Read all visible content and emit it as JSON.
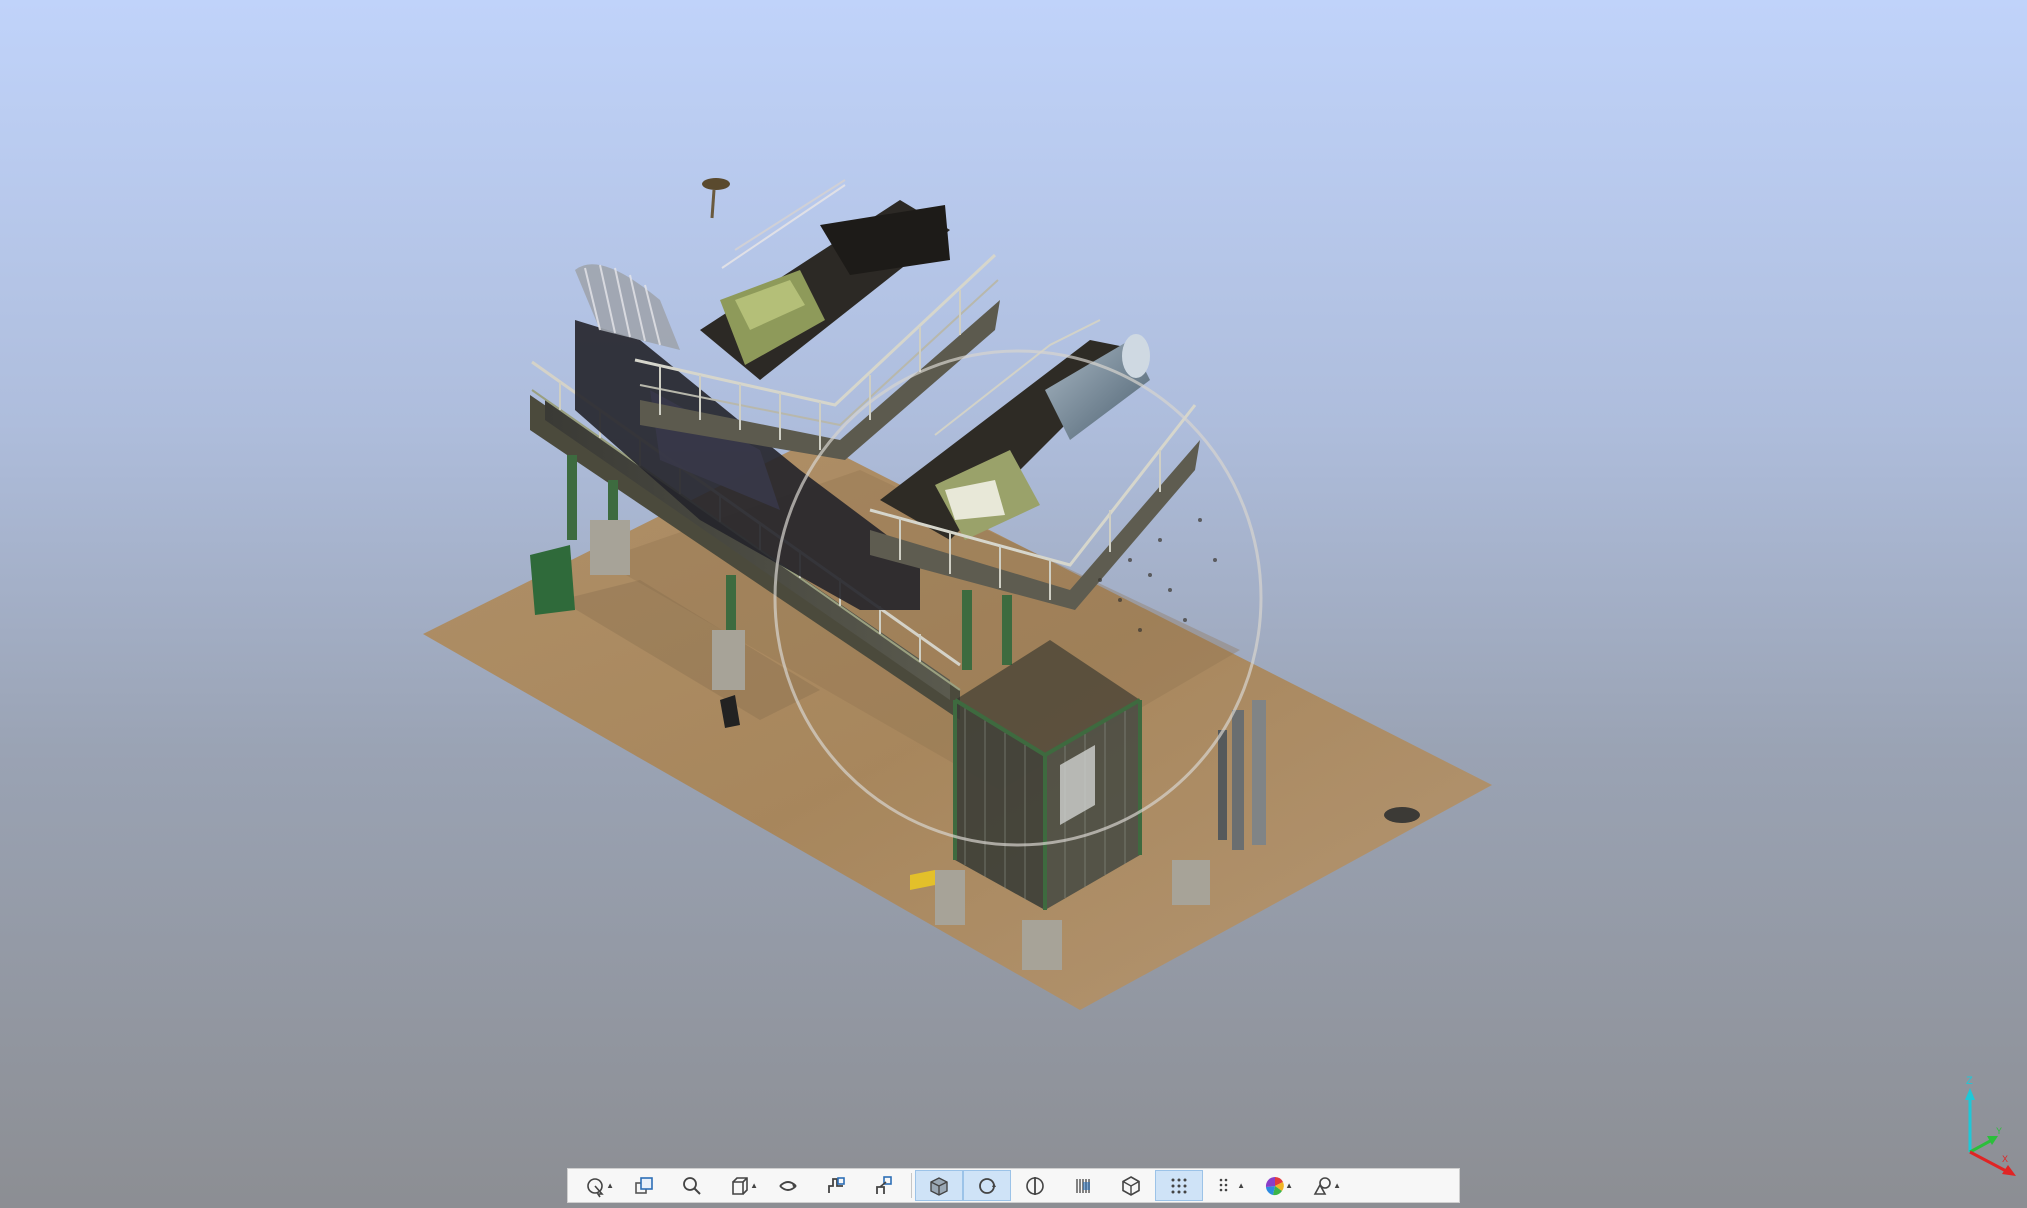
{
  "viewer": {
    "background_top": "#c0d3fa",
    "background_bottom": "#8c8e93",
    "navigation_orbit_visible": true
  },
  "toolbar": {
    "buttons": [
      {
        "name": "select-tool-button",
        "icon": "cursor-icon",
        "has_dropdown": true,
        "active": false
      },
      {
        "name": "zoom-extents-button",
        "icon": "zoom-extents-icon",
        "has_dropdown": false,
        "active": false
      },
      {
        "name": "zoom-button",
        "icon": "magnifier-icon",
        "has_dropdown": false,
        "active": false
      },
      {
        "name": "view-cube-button",
        "icon": "view-cube-icon",
        "has_dropdown": true,
        "active": false
      },
      {
        "name": "rotate-view-button",
        "icon": "rotate-icon",
        "has_dropdown": false,
        "active": false
      },
      {
        "name": "pan-view-button",
        "icon": "pan-hand-icon",
        "has_dropdown": false,
        "active": false
      },
      {
        "name": "walk-view-button",
        "icon": "walk-icon",
        "has_dropdown": false,
        "active": false
      },
      {
        "name": "orbit-mode-button",
        "icon": "orbit-cube-icon",
        "has_dropdown": false,
        "active": true
      },
      {
        "name": "orbit-center-button",
        "icon": "orbit-center-icon",
        "has_dropdown": false,
        "active": true
      },
      {
        "name": "section-button",
        "icon": "section-icon",
        "has_dropdown": false,
        "active": false
      },
      {
        "name": "clipping-box-button",
        "icon": "clip-box-icon",
        "has_dropdown": false,
        "active": false
      },
      {
        "name": "limit-box-button",
        "icon": "hexagon-box-icon",
        "has_dropdown": false,
        "active": false
      },
      {
        "name": "point-display-button",
        "icon": "point-grid-icon",
        "has_dropdown": false,
        "active": true
      },
      {
        "name": "point-size-button",
        "icon": "point-size-icon",
        "has_dropdown": true,
        "active": false
      },
      {
        "name": "color-mode-button",
        "icon": "color-wheel-icon",
        "has_dropdown": true,
        "active": false
      },
      {
        "name": "display-settings-button",
        "icon": "shapes-icon",
        "has_dropdown": true,
        "active": false
      }
    ]
  },
  "axis_gizmo": {
    "z_label": "Z",
    "y_label": "Y",
    "x_label": "X",
    "z_color": "#1ec8d8",
    "y_color": "#2bbf3b",
    "x_color": "#e02424"
  }
}
